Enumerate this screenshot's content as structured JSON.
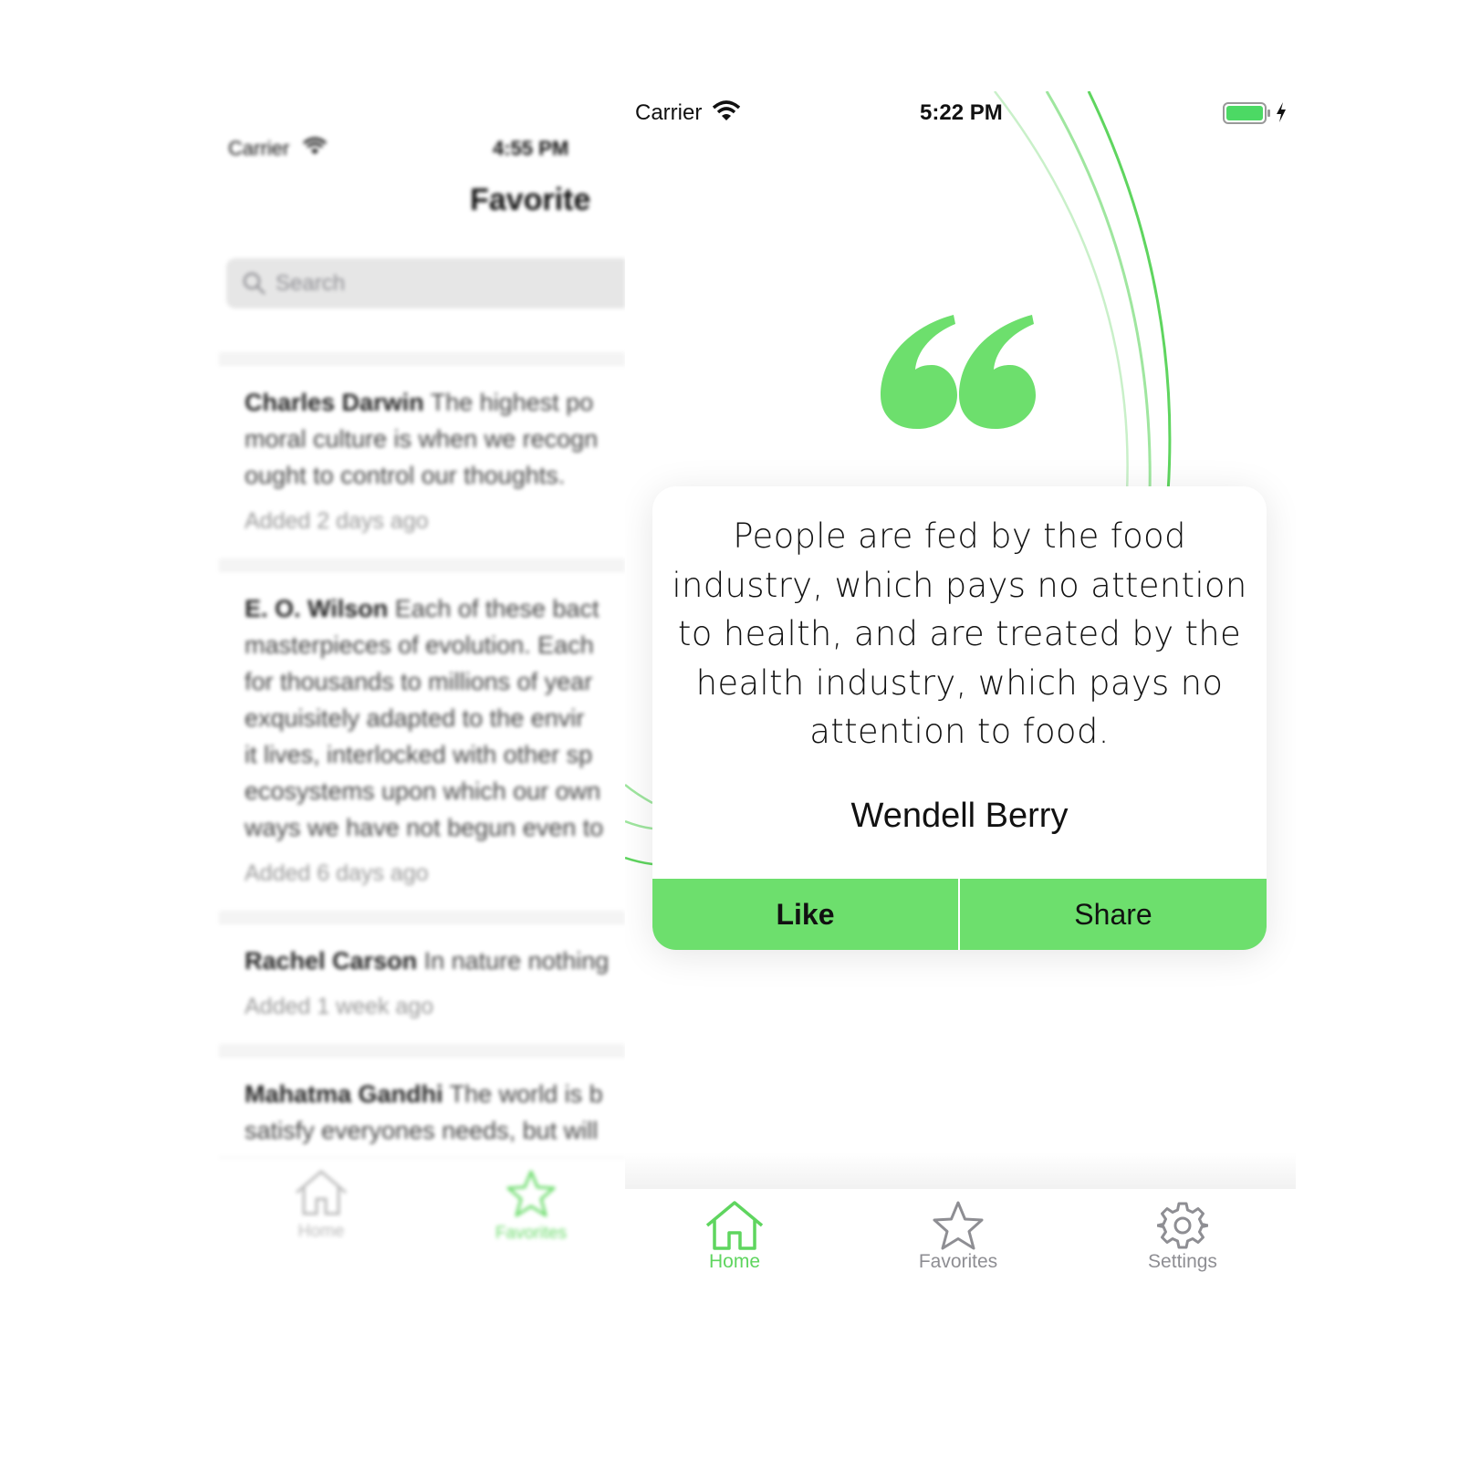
{
  "colors": {
    "accent": "#6ddf6d",
    "accent_dark": "#5fd55f",
    "inactive": "#8e8e93",
    "text": "#111111"
  },
  "background_screen": {
    "status_bar": {
      "carrier": "Carrier",
      "time": "4:55 PM"
    },
    "title": "Favorite",
    "search": {
      "placeholder": "Search"
    },
    "items": [
      {
        "author": "Charles Darwin",
        "text": "The highest po\nmoral culture is when we recogn\nought to control our thoughts.",
        "added": "Added 2 days ago"
      },
      {
        "author": "E. O. Wilson",
        "text": "Each of these bact\nmasterpieces of evolution. Each\nfor thousands to millions of year\nexquisitely adapted to the envir\nit lives, interlocked with other sp\necosystems upon which our own\nways we have not begun even to",
        "added": "Added 6 days ago"
      },
      {
        "author": "Rachel Carson",
        "text": "In nature nothing",
        "added": "Added 1 week ago"
      },
      {
        "author": "Mahatma Gandhi",
        "text": "The world is b\nsatisfy everyones needs, but will",
        "added": ""
      }
    ],
    "tabs": {
      "home": "Home",
      "favorites": "Favorites"
    }
  },
  "main_screen": {
    "status_bar": {
      "carrier": "Carrier",
      "time": "5:22 PM"
    },
    "quote": {
      "text": "People are fed by the food industry, which pays no attention to health, and are treated by the health industry, which pays no attention to food.",
      "author": "Wendell Berry"
    },
    "actions": {
      "like": "Like",
      "share": "Share"
    },
    "tabs": {
      "home": "Home",
      "favorites": "Favorites",
      "settings": "Settings"
    },
    "icons": [
      "wifi-icon",
      "battery-icon",
      "charging-bolt-icon",
      "quote-mark-icon",
      "home-icon",
      "star-icon",
      "gear-icon"
    ]
  }
}
